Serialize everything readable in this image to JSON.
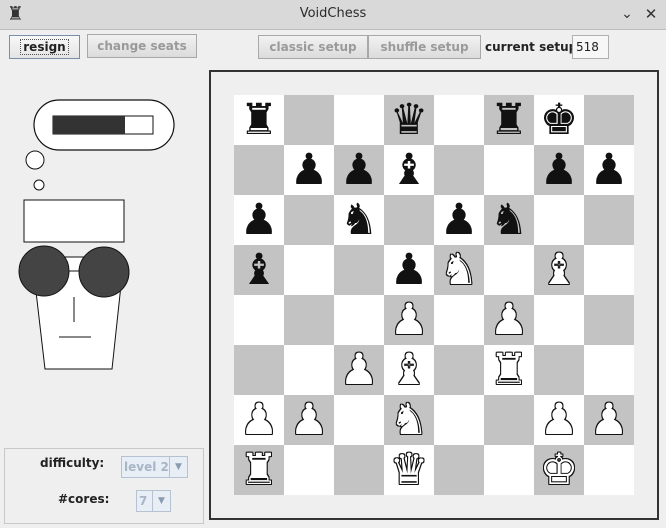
{
  "window": {
    "title": "VoidChess",
    "app_icon": "rook-icon",
    "minimize": "⌄",
    "close": "✕"
  },
  "toolbar": {
    "resign_label": "resign",
    "change_seats_label": "change seats",
    "classic_setup_label": "classic setup",
    "shuffle_setup_label": "shuffle setup",
    "current_setup_label": "current setup:",
    "current_setup_value": "518"
  },
  "options": {
    "difficulty_label": "difficulty:",
    "difficulty_value": "level 2",
    "cores_label": "#cores:",
    "cores_value": "7"
  },
  "opponent": {
    "thinking_progress": 0.72
  },
  "board": {
    "rows": [
      [
        "bR",
        "",
        "",
        "bQ",
        "",
        "bR",
        "bK",
        ""
      ],
      [
        "",
        "bP",
        "bP",
        "bB",
        "",
        "",
        "bP",
        "bP"
      ],
      [
        "bP",
        "",
        "bN",
        "",
        "bP",
        "bN",
        "",
        ""
      ],
      [
        "bB",
        "",
        "",
        "bP",
        "wN",
        "",
        "wB",
        ""
      ],
      [
        "",
        "",
        "",
        "wP",
        "",
        "wP",
        "",
        ""
      ],
      [
        "",
        "",
        "wP",
        "wB",
        "",
        "wR",
        "",
        ""
      ],
      [
        "wP",
        "wP",
        "",
        "wN",
        "",
        "",
        "wP",
        "wP"
      ],
      [
        "wR",
        "",
        "",
        "wQ",
        "",
        "",
        "wK",
        ""
      ]
    ]
  }
}
